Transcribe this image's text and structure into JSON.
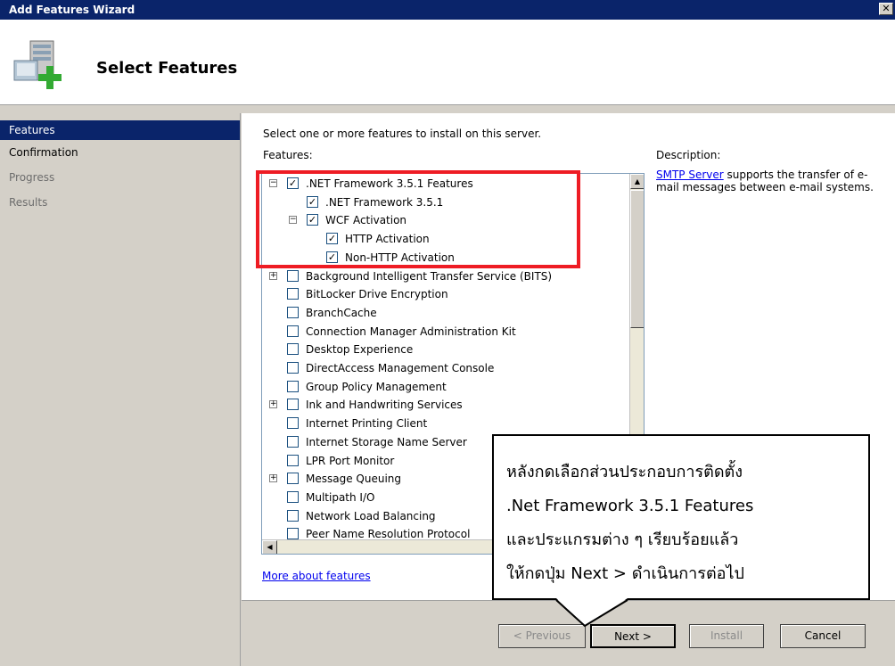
{
  "window": {
    "title": "Add Features Wizard",
    "close": "✕"
  },
  "header": {
    "title": "Select Features",
    "icon": "server-add-icon"
  },
  "sidebar": {
    "items": [
      {
        "label": "Features",
        "state": "active"
      },
      {
        "label": "Confirmation",
        "state": "normal"
      },
      {
        "label": "Progress",
        "state": "dim"
      },
      {
        "label": "Results",
        "state": "dim"
      }
    ]
  },
  "main": {
    "instruction": "Select one or more features to install on this server.",
    "features_label": "Features:",
    "description_label": "Description:",
    "description_link": "SMTP Server",
    "description_text": " supports the transfer of e-mail messages between e-mail systems.",
    "more_link": "More about features"
  },
  "tree": [
    {
      "label": ".NET Framework 3.5.1 Features",
      "level": 0,
      "expander": "−",
      "checked": true
    },
    {
      "label": ".NET Framework 3.5.1",
      "level": 1,
      "expander": "",
      "checked": true
    },
    {
      "label": "WCF Activation",
      "level": 1,
      "expander": "−",
      "checked": true
    },
    {
      "label": "HTTP Activation",
      "level": 2,
      "expander": "",
      "checked": true
    },
    {
      "label": "Non-HTTP Activation",
      "level": 2,
      "expander": "",
      "checked": true
    },
    {
      "label": "Background Intelligent Transfer Service (BITS)",
      "level": 0,
      "expander": "+",
      "checked": false
    },
    {
      "label": "BitLocker Drive Encryption",
      "level": 0,
      "expander": "",
      "checked": false
    },
    {
      "label": "BranchCache",
      "level": 0,
      "expander": "",
      "checked": false
    },
    {
      "label": "Connection Manager Administration Kit",
      "level": 0,
      "expander": "",
      "checked": false
    },
    {
      "label": "Desktop Experience",
      "level": 0,
      "expander": "",
      "checked": false
    },
    {
      "label": "DirectAccess Management Console",
      "level": 0,
      "expander": "",
      "checked": false
    },
    {
      "label": "Group Policy Management",
      "level": 0,
      "expander": "",
      "checked": false
    },
    {
      "label": "Ink and Handwriting Services",
      "level": 0,
      "expander": "+",
      "checked": false
    },
    {
      "label": "Internet Printing Client",
      "level": 0,
      "expander": "",
      "checked": false
    },
    {
      "label": "Internet Storage Name Server",
      "level": 0,
      "expander": "",
      "checked": false
    },
    {
      "label": "LPR Port Monitor",
      "level": 0,
      "expander": "",
      "checked": false
    },
    {
      "label": "Message Queuing",
      "level": 0,
      "expander": "+",
      "checked": false
    },
    {
      "label": "Multipath I/O",
      "level": 0,
      "expander": "",
      "checked": false
    },
    {
      "label": "Network Load Balancing",
      "level": 0,
      "expander": "",
      "checked": false
    },
    {
      "label": "Peer Name Resolution Protocol",
      "level": 0,
      "expander": "",
      "checked": false
    }
  ],
  "buttons": {
    "previous": "< Previous",
    "next": "Next >",
    "install": "Install",
    "cancel": "Cancel"
  },
  "callout": {
    "lines": [
      "หลังกดเลือกส่วนประกอบการติดตั้ง",
      ".Net Framework 3.5.1 Features",
      "และประแกรมต่าง ๆ เรียบร้อยแล้ว",
      "ให้กดปุ่ม Next > ดำเนินการต่อไป"
    ]
  },
  "colors": {
    "titlebar": "#0a246a",
    "highlight": "#ee1c24",
    "link": "#0000ee"
  }
}
